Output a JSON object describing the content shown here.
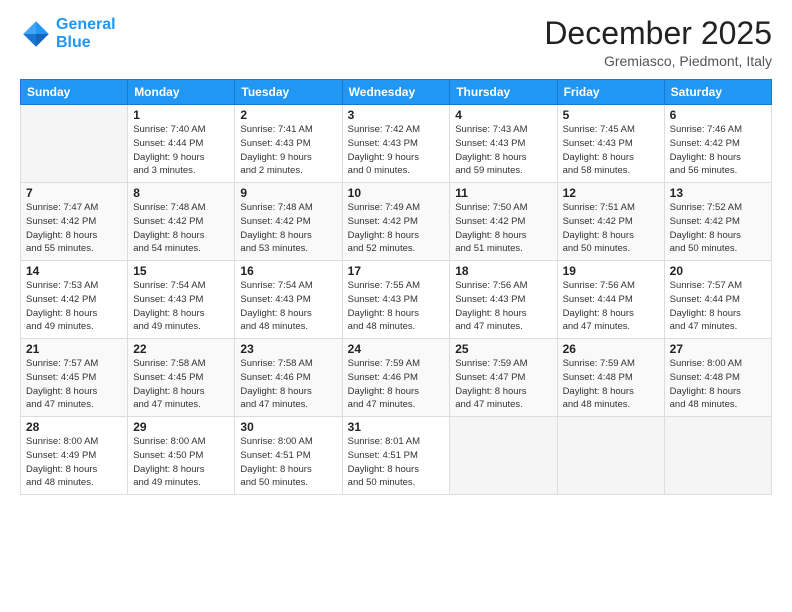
{
  "header": {
    "logo_line1": "General",
    "logo_line2": "Blue",
    "month": "December 2025",
    "location": "Gremiasco, Piedmont, Italy"
  },
  "days_of_week": [
    "Sunday",
    "Monday",
    "Tuesday",
    "Wednesday",
    "Thursday",
    "Friday",
    "Saturday"
  ],
  "weeks": [
    [
      {
        "num": "",
        "info": ""
      },
      {
        "num": "1",
        "info": "Sunrise: 7:40 AM\nSunset: 4:44 PM\nDaylight: 9 hours\nand 3 minutes."
      },
      {
        "num": "2",
        "info": "Sunrise: 7:41 AM\nSunset: 4:43 PM\nDaylight: 9 hours\nand 2 minutes."
      },
      {
        "num": "3",
        "info": "Sunrise: 7:42 AM\nSunset: 4:43 PM\nDaylight: 9 hours\nand 0 minutes."
      },
      {
        "num": "4",
        "info": "Sunrise: 7:43 AM\nSunset: 4:43 PM\nDaylight: 8 hours\nand 59 minutes."
      },
      {
        "num": "5",
        "info": "Sunrise: 7:45 AM\nSunset: 4:43 PM\nDaylight: 8 hours\nand 58 minutes."
      },
      {
        "num": "6",
        "info": "Sunrise: 7:46 AM\nSunset: 4:42 PM\nDaylight: 8 hours\nand 56 minutes."
      }
    ],
    [
      {
        "num": "7",
        "info": "Sunrise: 7:47 AM\nSunset: 4:42 PM\nDaylight: 8 hours\nand 55 minutes."
      },
      {
        "num": "8",
        "info": "Sunrise: 7:48 AM\nSunset: 4:42 PM\nDaylight: 8 hours\nand 54 minutes."
      },
      {
        "num": "9",
        "info": "Sunrise: 7:48 AM\nSunset: 4:42 PM\nDaylight: 8 hours\nand 53 minutes."
      },
      {
        "num": "10",
        "info": "Sunrise: 7:49 AM\nSunset: 4:42 PM\nDaylight: 8 hours\nand 52 minutes."
      },
      {
        "num": "11",
        "info": "Sunrise: 7:50 AM\nSunset: 4:42 PM\nDaylight: 8 hours\nand 51 minutes."
      },
      {
        "num": "12",
        "info": "Sunrise: 7:51 AM\nSunset: 4:42 PM\nDaylight: 8 hours\nand 50 minutes."
      },
      {
        "num": "13",
        "info": "Sunrise: 7:52 AM\nSunset: 4:42 PM\nDaylight: 8 hours\nand 50 minutes."
      }
    ],
    [
      {
        "num": "14",
        "info": "Sunrise: 7:53 AM\nSunset: 4:42 PM\nDaylight: 8 hours\nand 49 minutes."
      },
      {
        "num": "15",
        "info": "Sunrise: 7:54 AM\nSunset: 4:43 PM\nDaylight: 8 hours\nand 49 minutes."
      },
      {
        "num": "16",
        "info": "Sunrise: 7:54 AM\nSunset: 4:43 PM\nDaylight: 8 hours\nand 48 minutes."
      },
      {
        "num": "17",
        "info": "Sunrise: 7:55 AM\nSunset: 4:43 PM\nDaylight: 8 hours\nand 48 minutes."
      },
      {
        "num": "18",
        "info": "Sunrise: 7:56 AM\nSunset: 4:43 PM\nDaylight: 8 hours\nand 47 minutes."
      },
      {
        "num": "19",
        "info": "Sunrise: 7:56 AM\nSunset: 4:44 PM\nDaylight: 8 hours\nand 47 minutes."
      },
      {
        "num": "20",
        "info": "Sunrise: 7:57 AM\nSunset: 4:44 PM\nDaylight: 8 hours\nand 47 minutes."
      }
    ],
    [
      {
        "num": "21",
        "info": "Sunrise: 7:57 AM\nSunset: 4:45 PM\nDaylight: 8 hours\nand 47 minutes."
      },
      {
        "num": "22",
        "info": "Sunrise: 7:58 AM\nSunset: 4:45 PM\nDaylight: 8 hours\nand 47 minutes."
      },
      {
        "num": "23",
        "info": "Sunrise: 7:58 AM\nSunset: 4:46 PM\nDaylight: 8 hours\nand 47 minutes."
      },
      {
        "num": "24",
        "info": "Sunrise: 7:59 AM\nSunset: 4:46 PM\nDaylight: 8 hours\nand 47 minutes."
      },
      {
        "num": "25",
        "info": "Sunrise: 7:59 AM\nSunset: 4:47 PM\nDaylight: 8 hours\nand 47 minutes."
      },
      {
        "num": "26",
        "info": "Sunrise: 7:59 AM\nSunset: 4:48 PM\nDaylight: 8 hours\nand 48 minutes."
      },
      {
        "num": "27",
        "info": "Sunrise: 8:00 AM\nSunset: 4:48 PM\nDaylight: 8 hours\nand 48 minutes."
      }
    ],
    [
      {
        "num": "28",
        "info": "Sunrise: 8:00 AM\nSunset: 4:49 PM\nDaylight: 8 hours\nand 48 minutes."
      },
      {
        "num": "29",
        "info": "Sunrise: 8:00 AM\nSunset: 4:50 PM\nDaylight: 8 hours\nand 49 minutes."
      },
      {
        "num": "30",
        "info": "Sunrise: 8:00 AM\nSunset: 4:51 PM\nDaylight: 8 hours\nand 50 minutes."
      },
      {
        "num": "31",
        "info": "Sunrise: 8:01 AM\nSunset: 4:51 PM\nDaylight: 8 hours\nand 50 minutes."
      },
      {
        "num": "",
        "info": ""
      },
      {
        "num": "",
        "info": ""
      },
      {
        "num": "",
        "info": ""
      }
    ]
  ]
}
